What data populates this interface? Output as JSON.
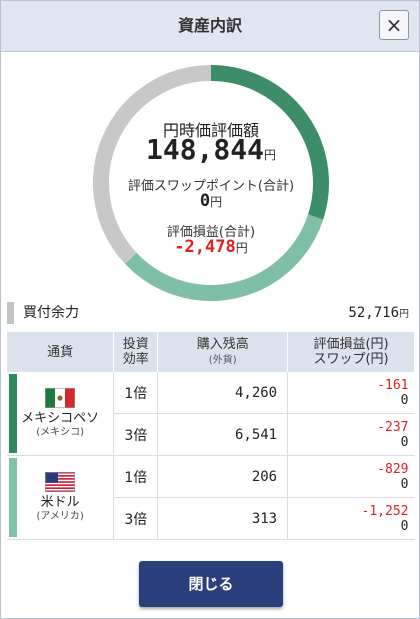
{
  "header": {
    "title": "資産内訳",
    "close_icon": "×"
  },
  "summary": {
    "valuation_label": "円時価評価額",
    "valuation_value": "148,844",
    "swap_label": "評価スワップポイント(合計)",
    "swap_value": "0",
    "pl_label": "評価損益(合計)",
    "pl_value": "-2,478",
    "unit": "円"
  },
  "donut": {
    "segments": [
      {
        "name": "メキシコペソ",
        "fraction": 0.3,
        "color": "#3c8d68"
      },
      {
        "name": "米ドル",
        "fraction": 0.33,
        "color": "#7fbfa6"
      },
      {
        "name": "買付余力",
        "fraction": 0.37,
        "color": "#c8c8c8"
      }
    ]
  },
  "buying_power": {
    "label": "買付余力",
    "value": "52,716",
    "unit": "円"
  },
  "table": {
    "headers": {
      "currency": "通貨",
      "leverage_1": "投資",
      "leverage_2": "効率",
      "position_1": "購入残高",
      "position_2": "(外貨)",
      "pl_1": "評価損益(円)",
      "pl_2": "スワップ(円)"
    },
    "groups": [
      {
        "name": "メキシコペソ",
        "country": "(メキシコ)",
        "flag": "mexico-flag-icon",
        "color": "#2e8a5c",
        "rows": [
          {
            "leverage": "1倍",
            "amount": "4,260",
            "pl": "-161",
            "swap": "0"
          },
          {
            "leverage": "3倍",
            "amount": "6,541",
            "pl": "-237",
            "swap": "0"
          }
        ]
      },
      {
        "name": "米ドル",
        "country": "(アメリカ)",
        "flag": "us-flag-icon",
        "color": "#7fc2aa",
        "rows": [
          {
            "leverage": "1倍",
            "amount": "206",
            "pl": "-829",
            "swap": "0"
          },
          {
            "leverage": "3倍",
            "amount": "313",
            "pl": "-1,252",
            "swap": "0"
          }
        ]
      }
    ]
  },
  "footer": {
    "close_label": "閉じる"
  }
}
